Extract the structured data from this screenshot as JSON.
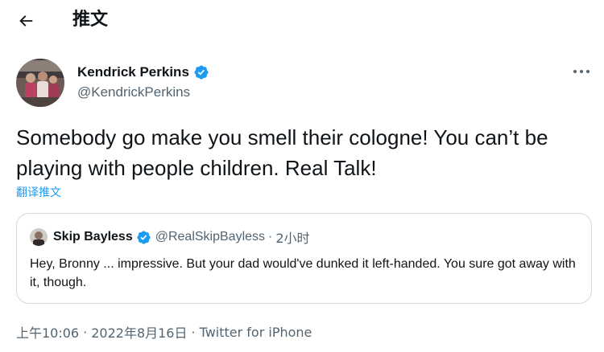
{
  "header": {
    "back_icon": "arrow-left-icon",
    "title": "推文"
  },
  "tweet": {
    "author": {
      "display_name": "Kendrick Perkins",
      "handle": "@KendrickPerkins",
      "verified": true
    },
    "more_icon": "more-horizontal-icon",
    "text": "Somebody go make you smell their cologne! You can’t be playing with people children. Real Talk!",
    "translate_label": "翻译推文",
    "quoted": {
      "display_name": "Skip Bayless",
      "verified": true,
      "handle": "@RealSkipBayless",
      "separator": "·",
      "time": "2小时",
      "text": "Hey, Bronny ... impressive. But your dad would've dunked it left-handed. You sure got away with it, though."
    },
    "timestamp": "上午10:06",
    "date": "2022年8月16日",
    "separator": "·",
    "source": "Twitter for iPhone"
  },
  "colors": {
    "accent": "#1d9bf0",
    "text_primary": "#0f1419",
    "text_secondary": "#536471",
    "border": "#cfd9de"
  }
}
